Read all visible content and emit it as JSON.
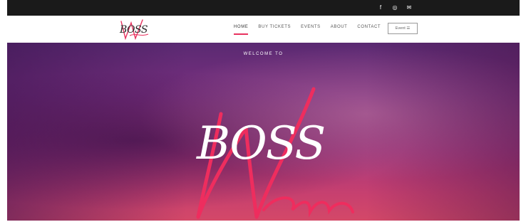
{
  "social": {
    "icons": [
      "facebook-icon",
      "instagram-icon",
      "email-icon"
    ],
    "glyphs": [
      "f",
      "◎",
      "✉"
    ]
  },
  "brand": {
    "logo_text": "BOSS",
    "script_text": "Women",
    "accent": "#e8325f"
  },
  "nav": {
    "items": [
      {
        "label": "HOME",
        "active": true
      },
      {
        "label": "BUY TICKETS",
        "active": false
      },
      {
        "label": "EVENTS",
        "active": false
      },
      {
        "label": "ABOUT",
        "active": false
      },
      {
        "label": "CONTACT",
        "active": false
      }
    ],
    "cta_label": "Event ☰"
  },
  "hero": {
    "welcome": "WELCOME TO",
    "title": "BOSS",
    "script": "Women"
  }
}
